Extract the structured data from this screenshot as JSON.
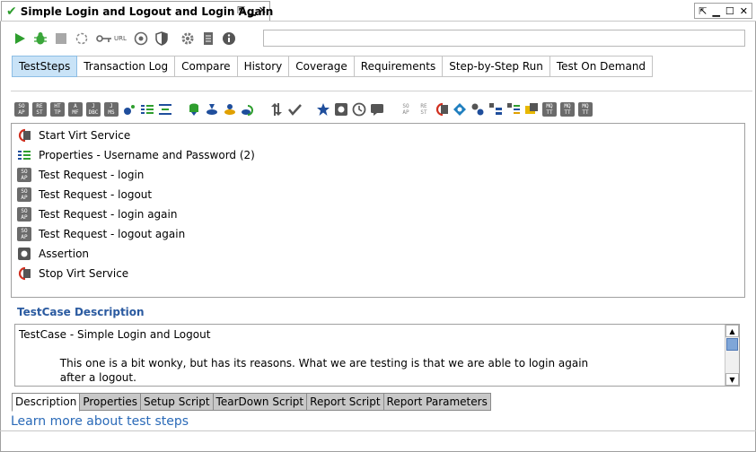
{
  "window": {
    "title": "Simple Login and Logout and Login Again"
  },
  "tabs": [
    {
      "label": "TestSteps",
      "selected": true
    },
    {
      "label": "Transaction Log"
    },
    {
      "label": "Compare"
    },
    {
      "label": "History"
    },
    {
      "label": "Coverage"
    },
    {
      "label": "Requirements"
    },
    {
      "label": "Step-by-Step Run"
    },
    {
      "label": "Test On Demand"
    }
  ],
  "toolbar": {
    "url_label": "URL"
  },
  "step_tools": [
    "SO\nAP",
    "RE\nST",
    "HT\nTP",
    "A\nMF",
    "J\nDBC",
    "J\nMS",
    "",
    "",
    "",
    "",
    "",
    "",
    "",
    "",
    "",
    "",
    "",
    "",
    "SO\nAP",
    "RE\nST",
    "",
    "",
    "",
    "",
    "",
    "",
    "MQ\nTT",
    "MQ\nTT",
    "MQ\nTT"
  ],
  "steps": [
    {
      "label": "Start Virt Service",
      "icon": "virt-icon"
    },
    {
      "label": "Properties - Username and Password (2)",
      "icon": "properties-icon"
    },
    {
      "label": "Test Request - login",
      "icon": "soap-icon",
      "badge": "SO\nAP"
    },
    {
      "label": "Test Request - logout",
      "icon": "soap-icon",
      "badge": "SO\nAP"
    },
    {
      "label": "Test Request - login again",
      "icon": "soap-icon",
      "badge": "SO\nAP"
    },
    {
      "label": "Test Request - logout again",
      "icon": "soap-icon",
      "badge": "SO\nAP"
    },
    {
      "label": "Assertion",
      "icon": "assertion-icon"
    },
    {
      "label": "Stop Virt Service",
      "icon": "virt-icon"
    }
  ],
  "description": {
    "title": "TestCase Description",
    "text": "TestCase - Simple Login and Logout\n\n            This one is a bit wonky, but has its reasons. What we are testing is that we are able to login again\n            after a logout."
  },
  "bottom_tabs": [
    {
      "label": "Description",
      "selected": true
    },
    {
      "label": "Properties"
    },
    {
      "label": "Setup Script"
    },
    {
      "label": "TearDown Script"
    },
    {
      "label": "Report Script"
    },
    {
      "label": "Report Parameters"
    }
  ],
  "learn_more": "Learn more about test steps"
}
